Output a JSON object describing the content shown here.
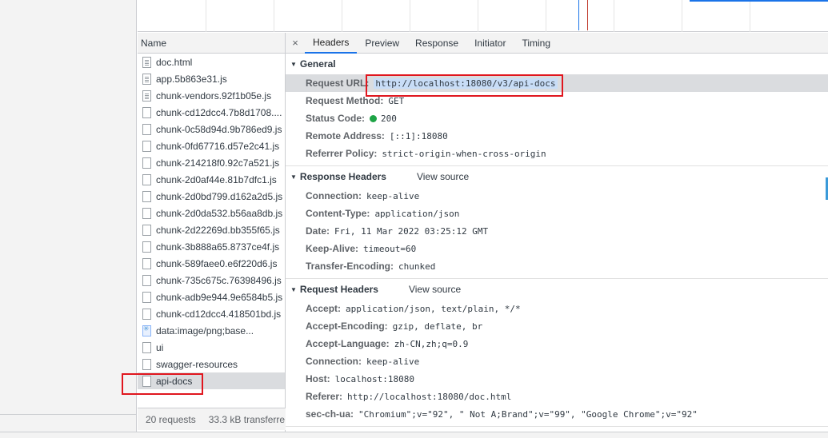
{
  "name_header": "Name",
  "files": [
    {
      "name": "doc.html",
      "icon": "document-icon"
    },
    {
      "name": "app.5b863e31.js",
      "icon": "document-icon"
    },
    {
      "name": "chunk-vendors.92f1b05e.js",
      "icon": "document-icon"
    },
    {
      "name": "chunk-cd12dcc4.7b8d1708....",
      "icon": "file-icon"
    },
    {
      "name": "chunk-0c58d94d.9b786ed9.js",
      "icon": "file-icon"
    },
    {
      "name": "chunk-0fd67716.d57e2c41.js",
      "icon": "file-icon"
    },
    {
      "name": "chunk-214218f0.92c7a521.js",
      "icon": "file-icon"
    },
    {
      "name": "chunk-2d0af44e.81b7dfc1.js",
      "icon": "file-icon"
    },
    {
      "name": "chunk-2d0bd799.d162a2d5.js",
      "icon": "file-icon"
    },
    {
      "name": "chunk-2d0da532.b56aa8db.js",
      "icon": "file-icon"
    },
    {
      "name": "chunk-2d22269d.bb355f65.js",
      "icon": "file-icon"
    },
    {
      "name": "chunk-3b888a65.8737ce4f.js",
      "icon": "file-icon"
    },
    {
      "name": "chunk-589faee0.e6f220d6.js",
      "icon": "file-icon"
    },
    {
      "name": "chunk-735c675c.76398496.js",
      "icon": "file-icon"
    },
    {
      "name": "chunk-adb9e944.9e6584b5.js",
      "icon": "file-icon"
    },
    {
      "name": "chunk-cd12dcc4.418501bd.js",
      "icon": "file-icon"
    },
    {
      "name": "data:image/png;base...",
      "icon": "image-icon"
    },
    {
      "name": "ui",
      "icon": "file-icon"
    },
    {
      "name": "swagger-resources",
      "icon": "file-icon"
    },
    {
      "name": "api-docs",
      "icon": "file-icon",
      "selected": true
    }
  ],
  "footer": {
    "requests": "20 requests",
    "transferred": "33.3 kB transferre"
  },
  "tabs": {
    "close": "×",
    "headers": "Headers",
    "preview": "Preview",
    "response": "Response",
    "initiator": "Initiator",
    "timing": "Timing"
  },
  "general": {
    "title": "General",
    "request_url_key": "Request URL:",
    "request_url": "http://localhost:18080/v3/api-docs",
    "request_method_key": "Request Method:",
    "request_method": "GET",
    "status_code_key": "Status Code:",
    "status_code": "200",
    "remote_address_key": "Remote Address:",
    "remote_address": "[::1]:18080",
    "referrer_policy_key": "Referrer Policy:",
    "referrer_policy": "strict-origin-when-cross-origin"
  },
  "response_headers": {
    "title": "Response Headers",
    "view_source": "View source",
    "rows": [
      {
        "key": "Connection:",
        "value": "keep-alive"
      },
      {
        "key": "Content-Type:",
        "value": "application/json"
      },
      {
        "key": "Date:",
        "value": "Fri, 11 Mar 2022 03:25:12 GMT"
      },
      {
        "key": "Keep-Alive:",
        "value": "timeout=60"
      },
      {
        "key": "Transfer-Encoding:",
        "value": "chunked"
      }
    ]
  },
  "request_headers": {
    "title": "Request Headers",
    "view_source": "View source",
    "rows": [
      {
        "key": "Accept:",
        "value": "application/json, text/plain, */*"
      },
      {
        "key": "Accept-Encoding:",
        "value": "gzip, deflate, br"
      },
      {
        "key": "Accept-Language:",
        "value": "zh-CN,zh;q=0.9"
      },
      {
        "key": "Connection:",
        "value": "keep-alive"
      },
      {
        "key": "Host:",
        "value": "localhost:18080"
      },
      {
        "key": "Referer:",
        "value": "http://localhost:18080/doc.html"
      },
      {
        "key": "sec-ch-ua:",
        "value": "\"Chromium\";v=\"92\", \" Not A;Brand\";v=\"99\", \"Google Chrome\";v=\"92\""
      }
    ]
  },
  "colors": {
    "accent": "#1a73e8",
    "status_ok": "#1ea446",
    "highlight_box": "#e0161e"
  }
}
